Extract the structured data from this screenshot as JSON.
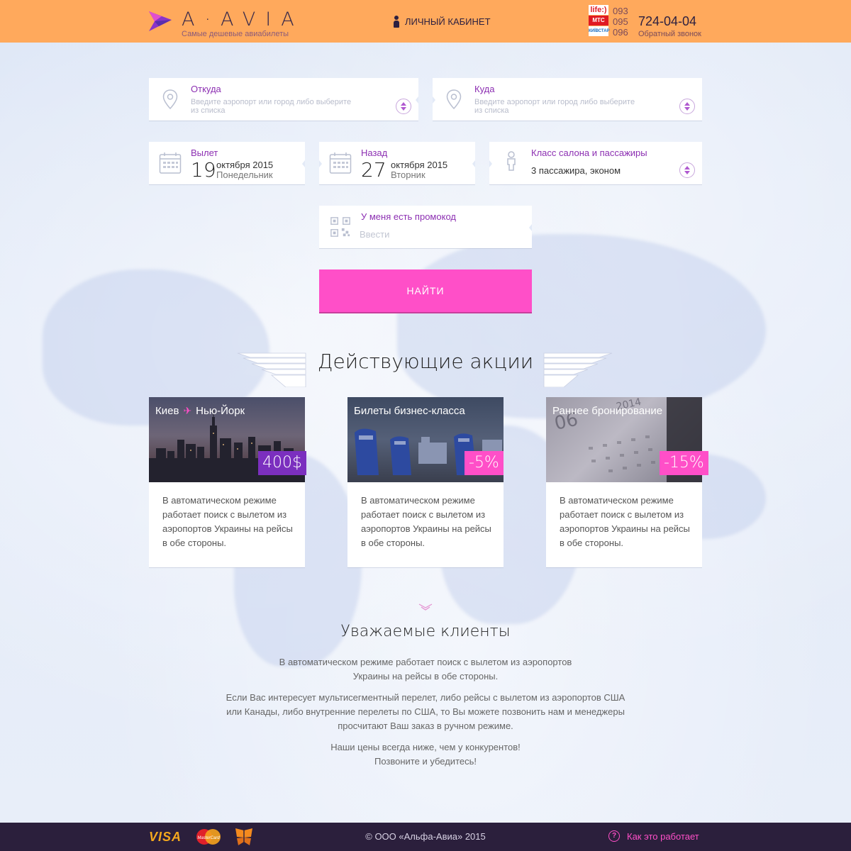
{
  "header": {
    "logo_text": "A·AVIA",
    "logo_subtitle": "Самые дешевые авиабилеты",
    "cabinet_label": "ЛИЧНЫЙ КАБИНЕТ",
    "operators": [
      "life:)",
      "МТС",
      "КИЇВСТАР"
    ],
    "codes": [
      "093",
      "095",
      "096"
    ],
    "phone": "724-04-04",
    "callback": "Обратный звонок"
  },
  "form": {
    "from": {
      "label": "Откуда",
      "hint": "Введите аэропорт или город либо выберите из списка"
    },
    "to": {
      "label": "Куда",
      "hint": "Введите аэропорт или город либо выберите из списка"
    },
    "depart": {
      "label": "Вылет",
      "day": "19",
      "month": "октября 2015",
      "weekday": "Понедельник"
    },
    "return": {
      "label": "Назад",
      "day": "27",
      "month": "октября 2015",
      "weekday": "Вторник"
    },
    "passengers": {
      "label": "Класс салона и пассажиры",
      "value": "3 пассажира, эконом"
    },
    "promo": {
      "label": "У меня есть промокод",
      "placeholder": "Ввести"
    },
    "search_label": "НАЙТИ"
  },
  "promos": {
    "title": "Действующие акции",
    "cards": [
      {
        "from": "Киев",
        "to": "Нью-Йорк",
        "badge": "400$",
        "text": "В автоматическом режиме работает поиск с вылетом из аэропортов Украины на рейсы в обе стороны."
      },
      {
        "title": "Билеты бизнес-класса",
        "badge": "-5%",
        "text": "В автоматическом режиме работает поиск с вылетом из аэропортов Украины на рейсы в обе стороны."
      },
      {
        "title": "Раннее бронирование",
        "badge": "-15%",
        "text": "В автоматическом режиме работает поиск с вылетом из аэропортов Украины на рейсы в обе стороны."
      }
    ]
  },
  "clients": {
    "title": "Уважаемые клиенты",
    "p1": "В автоматическом режиме работает поиск с вылетом из аэропортов Украины на рейсы в обе стороны.",
    "p2": "Если Вас интересует мультисегментный перелет, либо рейсы с вылетом из аэропортов США или Канады, либо внутренние перелеты по США, то Вы можете позвонить нам и менеджеры просчитают Ваш заказ в ручном режиме.",
    "p3": "Наши цены всегда ниже, чем у конкурентов! Позвоните и убедитесь!"
  },
  "footer": {
    "payments": [
      "VISA",
      "MasterCard",
      "Приватбанк"
    ],
    "copyright": "© ООО «Альфа-Авиа» 2015",
    "how_label": "Как это работает"
  },
  "colors": {
    "header_bg": "#ffa95c",
    "accent_pink": "#ff4fc8",
    "accent_purple": "#7b2fbf",
    "footer_bg": "#2b1f3c"
  }
}
